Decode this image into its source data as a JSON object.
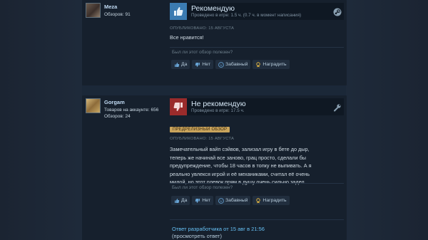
{
  "reviews": [
    {
      "author": {
        "name": "Meza",
        "reviews_count": "Обзоров: 91"
      },
      "verdict": "Рекомендую",
      "hours": "Проведено в игре: 1.5 ч. (0.7 ч. в момент написания)",
      "header_icon": "steam-icon",
      "posted": "ОПУБЛИКОВАНО: 15 АВГУСТА",
      "text": "Все нравится!",
      "helpful_question": "Был ли этот обзор полезен?",
      "votes": {
        "yes": "Да",
        "no": "Нет",
        "funny": "Забавный",
        "award": "Наградить"
      }
    },
    {
      "author": {
        "name": "Gorgam",
        "products": "Товаров на аккаунте: 656",
        "reviews_count": "Обзоров: 24"
      },
      "verdict": "Не рекомендую",
      "hours": "Проведено в игре: 17.5 ч.",
      "header_icon": "wrench-icon",
      "badge": "ПРЕДРЕЛИЗНЫЙ ОБЗОР",
      "posted": "ОПУБЛИКОВАНО: 15 АВГУСТА",
      "text_lines": [
        "Замечательный вайп сэйвов, зализал игру в бете до дыр,",
        "теперь же начинай все заново, грац просто, сделали бы",
        "предупреждение, чтобы 18 часов в топку не выпивать. А я",
        "реально увлекся игрой и её механиками, считал её очень",
        "милой, но этот плевок прям в душу очень сильно задел."
      ],
      "helpful_question": "Был ли этот обзор полезен?",
      "votes": {
        "yes": "Да",
        "no": "Нет",
        "funny": "Забавный",
        "award": "Наградить"
      },
      "dev_response": "Ответ разработчика от 15 авг в 21:56",
      "view_response": "(просмотреть ответ)"
    }
  ],
  "colors": {
    "page_bg": "#1b2838",
    "card_bg": "#16202d",
    "recommend": "#3b7bb1",
    "not_recommend": "#9a2b2b",
    "link": "#66c0f4",
    "badge": "#c9a45c"
  }
}
